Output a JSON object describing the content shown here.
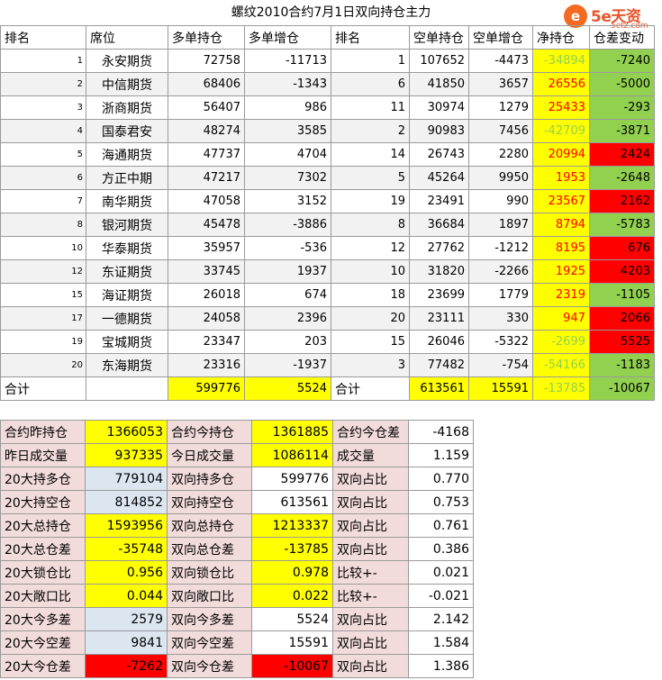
{
  "title": "螺纹2010合约7月1日双向持仓主力",
  "logo": {
    "mark": "e",
    "brand": "5e天资",
    "url": "5etz.com"
  },
  "headers": [
    "排名",
    "席位",
    "多单持仓",
    "多单增仓",
    "排名",
    "空单持仓",
    "空单增仓",
    "净持仓",
    "仓差变动"
  ],
  "rows": [
    {
      "rank": "1",
      "seat": "永安期货",
      "long": "72758",
      "long_chg": "-11713",
      "srank": "1",
      "short": "107652",
      "short_chg": "-4473",
      "net": "-34894",
      "diff": "-7240",
      "net_color": "yellow",
      "net_text": "lightgreen",
      "diff_color": "green"
    },
    {
      "rank": "2",
      "seat": "中信期货",
      "long": "68406",
      "long_chg": "-1343",
      "srank": "6",
      "short": "41850",
      "short_chg": "3657",
      "net": "26556",
      "diff": "-5000",
      "net_color": "yellow",
      "net_text": "red",
      "diff_color": "green"
    },
    {
      "rank": "3",
      "seat": "浙商期货",
      "long": "56407",
      "long_chg": "986",
      "srank": "11",
      "short": "30974",
      "short_chg": "1279",
      "net": "25433",
      "diff": "-293",
      "net_color": "yellow",
      "net_text": "red",
      "diff_color": "green"
    },
    {
      "rank": "4",
      "seat": "国泰君安",
      "long": "48274",
      "long_chg": "3585",
      "srank": "2",
      "short": "90983",
      "short_chg": "7456",
      "net": "-42709",
      "diff": "-3871",
      "net_color": "yellow",
      "net_text": "lightgreen",
      "diff_color": "green"
    },
    {
      "rank": "5",
      "seat": "海通期货",
      "long": "47737",
      "long_chg": "4704",
      "srank": "14",
      "short": "26743",
      "short_chg": "2280",
      "net": "20994",
      "diff": "2424",
      "net_color": "yellow",
      "net_text": "red",
      "diff_color": "red"
    },
    {
      "rank": "6",
      "seat": "方正中期",
      "long": "47217",
      "long_chg": "7302",
      "srank": "5",
      "short": "45264",
      "short_chg": "9950",
      "net": "1953",
      "diff": "-2648",
      "net_color": "yellow",
      "net_text": "red",
      "diff_color": "green"
    },
    {
      "rank": "7",
      "seat": "南华期货",
      "long": "47058",
      "long_chg": "3152",
      "srank": "19",
      "short": "23491",
      "short_chg": "990",
      "net": "23567",
      "diff": "2162",
      "net_color": "yellow",
      "net_text": "red",
      "diff_color": "red"
    },
    {
      "rank": "8",
      "seat": "银河期货",
      "long": "45478",
      "long_chg": "-3886",
      "srank": "8",
      "short": "36684",
      "short_chg": "1897",
      "net": "8794",
      "diff": "-5783",
      "net_color": "yellow",
      "net_text": "red",
      "diff_color": "green"
    },
    {
      "rank": "10",
      "seat": "华泰期货",
      "long": "35957",
      "long_chg": "-536",
      "srank": "12",
      "short": "27762",
      "short_chg": "-1212",
      "net": "8195",
      "diff": "676",
      "net_color": "yellow",
      "net_text": "red",
      "diff_color": "red"
    },
    {
      "rank": "12",
      "seat": "东证期货",
      "long": "33745",
      "long_chg": "1937",
      "srank": "10",
      "short": "31820",
      "short_chg": "-2266",
      "net": "1925",
      "diff": "4203",
      "net_color": "yellow",
      "net_text": "red",
      "diff_color": "red"
    },
    {
      "rank": "15",
      "seat": "海证期货",
      "long": "26018",
      "long_chg": "674",
      "srank": "18",
      "short": "23699",
      "short_chg": "1779",
      "net": "2319",
      "diff": "-1105",
      "net_color": "yellow",
      "net_text": "red",
      "diff_color": "green"
    },
    {
      "rank": "17",
      "seat": "一德期货",
      "long": "24058",
      "long_chg": "2396",
      "srank": "20",
      "short": "23111",
      "short_chg": "330",
      "net": "947",
      "diff": "2066",
      "net_color": "yellow",
      "net_text": "red",
      "diff_color": "red"
    },
    {
      "rank": "19",
      "seat": "宝城期货",
      "long": "23347",
      "long_chg": "203",
      "srank": "15",
      "short": "26046",
      "short_chg": "-5322",
      "net": "-2699",
      "diff": "5525",
      "net_color": "yellow",
      "net_text": "lightgreen",
      "diff_color": "red"
    },
    {
      "rank": "20",
      "seat": "东海期货",
      "long": "23316",
      "long_chg": "-1937",
      "srank": "3",
      "short": "77482",
      "short_chg": "-754",
      "net": "-54166",
      "diff": "-1183",
      "net_color": "yellow",
      "net_text": "lightgreen",
      "diff_color": "green"
    }
  ],
  "total": {
    "label": "合计",
    "long": "599776",
    "long_chg": "5524",
    "slabel": "合计",
    "short": "613561",
    "short_chg": "15591",
    "net": "-13785",
    "diff": "-10067"
  },
  "stats": [
    {
      "l1": "合约昨持仓",
      "v1": "1366053",
      "c1": "yellow",
      "l2": "合约今持仓",
      "v2": "1361885",
      "c2": "yellow",
      "l3": "合约今仓差",
      "v3": "-4168"
    },
    {
      "l1": "昨日成交量",
      "v1": "937335",
      "c1": "yellow",
      "l2": "今日成交量",
      "v2": "1086114",
      "c2": "yellow",
      "l3": "成交量",
      "v3": "1.159"
    },
    {
      "l1": "20大持多仓",
      "v1": "779104",
      "c1": "blue",
      "l2": "双向持多仓",
      "v2": "599776",
      "c2": "white",
      "l3": "双向占比",
      "v3": "0.770"
    },
    {
      "l1": "20大持空仓",
      "v1": "814852",
      "c1": "blue",
      "l2": "双向持空仓",
      "v2": "613561",
      "c2": "white",
      "l3": "双向占比",
      "v3": "0.753"
    },
    {
      "l1": "20大总持仓",
      "v1": "1593956",
      "c1": "yellow",
      "l2": "双向总持仓",
      "v2": "1213337",
      "c2": "yellow",
      "l3": "双向占比",
      "v3": "0.761"
    },
    {
      "l1": "20大总仓差",
      "v1": "-35748",
      "c1": "yellow",
      "l2": "双向总仓差",
      "v2": "-13785",
      "c2": "yellow",
      "l3": "双向占比",
      "v3": "0.386"
    },
    {
      "l1": "20大锁仓比",
      "v1": "0.956",
      "c1": "yellow",
      "l2": "双向锁仓比",
      "v2": "0.978",
      "c2": "yellow",
      "l3": "比较+-",
      "v3": "0.021"
    },
    {
      "l1": "20大敞口比",
      "v1": "0.044",
      "c1": "yellow",
      "l2": "双向敞口比",
      "v2": "0.022",
      "c2": "yellow",
      "l3": "比较+-",
      "v3": "-0.021"
    },
    {
      "l1": "20大今多差",
      "v1": "2579",
      "c1": "blue",
      "l2": "双向今多差",
      "v2": "5524",
      "c2": "white",
      "l3": "双向占比",
      "v3": "2.142"
    },
    {
      "l1": "20大今空差",
      "v1": "9841",
      "c1": "blue",
      "l2": "双向今空差",
      "v2": "15591",
      "c2": "white",
      "l3": "双向占比",
      "v3": "1.584"
    },
    {
      "l1": "20大今仓差",
      "v1": "-7262",
      "c1": "red",
      "l2": "双向今仓差",
      "v2": "-10067",
      "c2": "red",
      "l3": "双向占比",
      "v3": "1.386"
    }
  ]
}
